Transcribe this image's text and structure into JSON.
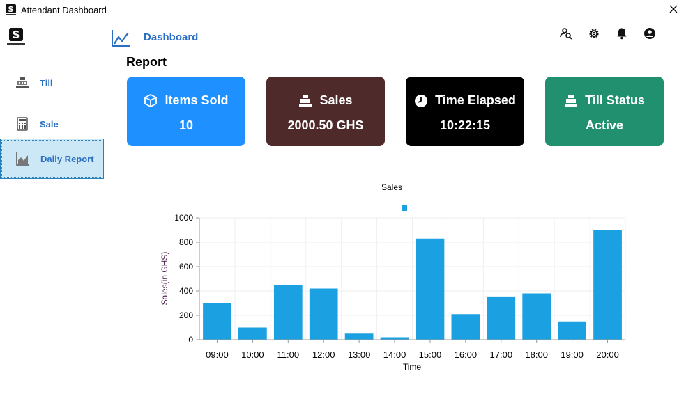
{
  "window": {
    "title": "Attendant Dashboard"
  },
  "sidebar": {
    "items": [
      {
        "label": "Till",
        "icon": "cash-register-icon"
      },
      {
        "label": "Sale",
        "icon": "calculator-icon"
      },
      {
        "label": "Daily Report",
        "icon": "area-chart-icon",
        "selected": true
      }
    ]
  },
  "header": {
    "title": "Dashboard",
    "icons": [
      "user-search-icon",
      "gear-icon",
      "bell-icon",
      "account-icon"
    ]
  },
  "report": {
    "title": "Report",
    "cards": [
      {
        "label": "Items Sold",
        "value": "10",
        "color": "#1e90ff",
        "icon": "box-icon"
      },
      {
        "label": "Sales",
        "value": "2000.50 GHS",
        "color": "#4f2a2a",
        "icon": "cash-register-icon"
      },
      {
        "label": "Time Elapsed",
        "value": "10:22:15",
        "color": "#000000",
        "icon": "clock-icon"
      },
      {
        "label": "Till Status",
        "value": "Active",
        "color": "#21906e",
        "icon": "cash-register-icon"
      }
    ]
  },
  "chart_data": {
    "type": "bar",
    "title": "Sales",
    "xlabel": "Time",
    "ylabel": "Sales(in GHS)",
    "ylim": [
      0,
      1000
    ],
    "yticks": [
      0,
      200,
      400,
      600,
      800,
      1000
    ],
    "grid": true,
    "legend": "top",
    "bar_color": "#1ba1e2",
    "categories": [
      "09:00",
      "10:00",
      "11:00",
      "12:00",
      "13:00",
      "14:00",
      "15:00",
      "16:00",
      "17:00",
      "18:00",
      "19:00",
      "20:00"
    ],
    "values": [
      300,
      100,
      450,
      420,
      50,
      20,
      830,
      210,
      355,
      380,
      150,
      900
    ]
  }
}
